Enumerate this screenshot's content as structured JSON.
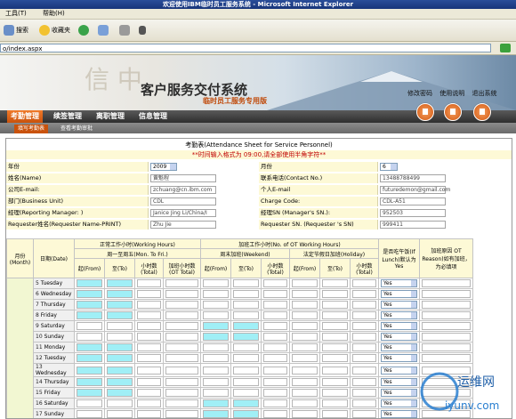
{
  "window": {
    "title": "欢迎使用IBM临时员工服务系统 - Microsoft Internet Explorer"
  },
  "menu": [
    "工具(T)",
    "帮助(H)"
  ],
  "toolbar": {
    "search_label": "搜索",
    "favorites_label": "收藏夹"
  },
  "address": {
    "url": "o/index.aspx"
  },
  "header": {
    "system_title": "客户服务交付系统",
    "system_subtitle": "临时员工服务专用版",
    "top_links": [
      "修改密码",
      "使用说明",
      "退出系统"
    ]
  },
  "nav": {
    "tabs": [
      {
        "label": "考勤管理",
        "active": true
      },
      {
        "label": "续签管理",
        "active": false
      },
      {
        "label": "离职管理",
        "active": false
      },
      {
        "label": "信息管理",
        "active": false
      }
    ],
    "sub_tabs": [
      {
        "label": "填写考勤表",
        "active": true
      },
      {
        "label": "查看考勤审批",
        "active": false
      }
    ]
  },
  "form": {
    "title": "考勤表(Attendance Sheet for Service Personnel)",
    "notice": "**时间输入格式为 09:00,请全部使用半角字符**",
    "year_label": "年份",
    "year_value": "2009",
    "month_label": "月份",
    "month_value": "6",
    "name_label": "姓名(Name)",
    "name_value": "黄魁程",
    "contact_label": "联系电话(Contact No.)",
    "contact_value": "13488788499",
    "company_email_label": "公司E-mail:",
    "company_email_value": "zchuang@cn.ibm.com",
    "personal_email_label": "个人E-mail",
    "personal_email_value": "futuredemon@gmail.com",
    "bu_label": "部门(Business Unit)",
    "bu_value": "CDL",
    "charge_label": "Charge Code:",
    "charge_value": "CDL-A51",
    "manager_label": "经理(Reporting Manager: )",
    "manager_value": "Janice Jing Li/China/I",
    "manager_sn_label": "经理SN (Manager's SN.):",
    "manager_sn_value": "952503",
    "requester_label": "Requester姓名(Requester Name-PRINT)",
    "requester_value": "Zhu Jie",
    "requester_sn_label": "Requester SN. (Requester 's SN)",
    "requester_sn_value": "999411"
  },
  "grid": {
    "month_header": "月份(Month)",
    "date_header": "日期(Date)",
    "normal_hours_header": "正常工作小时(Working Hours)",
    "ot_hours_header": "加班工作小时(No. of OT Working Hours)",
    "weekday_header": "周一至周五(Mon. To Fri.)",
    "weekend_header": "周末加班(Weekend)",
    "holiday_header": "法定节假日加班(Holiday)",
    "from_label": "起(From)",
    "to_label": "至(To)",
    "hours_total_label": "小时数(Total)",
    "ot_total_label": "加班小时数(OT Total)",
    "lunch_header": "是否吃午饭(If Lunch)默认为Yes",
    "reason_header": "加班原因 OT Reason)如有加班，为必填项",
    "lunch_default": "Yes",
    "rows": [
      {
        "num": "5",
        "day": "Tuesday",
        "weekend": false
      },
      {
        "num": "6",
        "day": "Wednesday",
        "weekend": false
      },
      {
        "num": "7",
        "day": "Thursday",
        "weekend": false
      },
      {
        "num": "8",
        "day": "Friday",
        "weekend": false
      },
      {
        "num": "9",
        "day": "Saturday",
        "weekend": true
      },
      {
        "num": "10",
        "day": "Sunday",
        "weekend": true
      },
      {
        "num": "11",
        "day": "Monday",
        "weekend": false
      },
      {
        "num": "12",
        "day": "Tuesday",
        "weekend": false
      },
      {
        "num": "13",
        "day": "Wednesday",
        "weekend": false
      },
      {
        "num": "14",
        "day": "Thursday",
        "weekend": false
      },
      {
        "num": "15",
        "day": "Friday",
        "weekend": false
      },
      {
        "num": "16",
        "day": "Saturday",
        "weekend": true
      },
      {
        "num": "17",
        "day": "Sunday",
        "weekend": true
      }
    ]
  },
  "watermark": {
    "text_cn": "运维网",
    "text_en": "iyunv.com"
  }
}
